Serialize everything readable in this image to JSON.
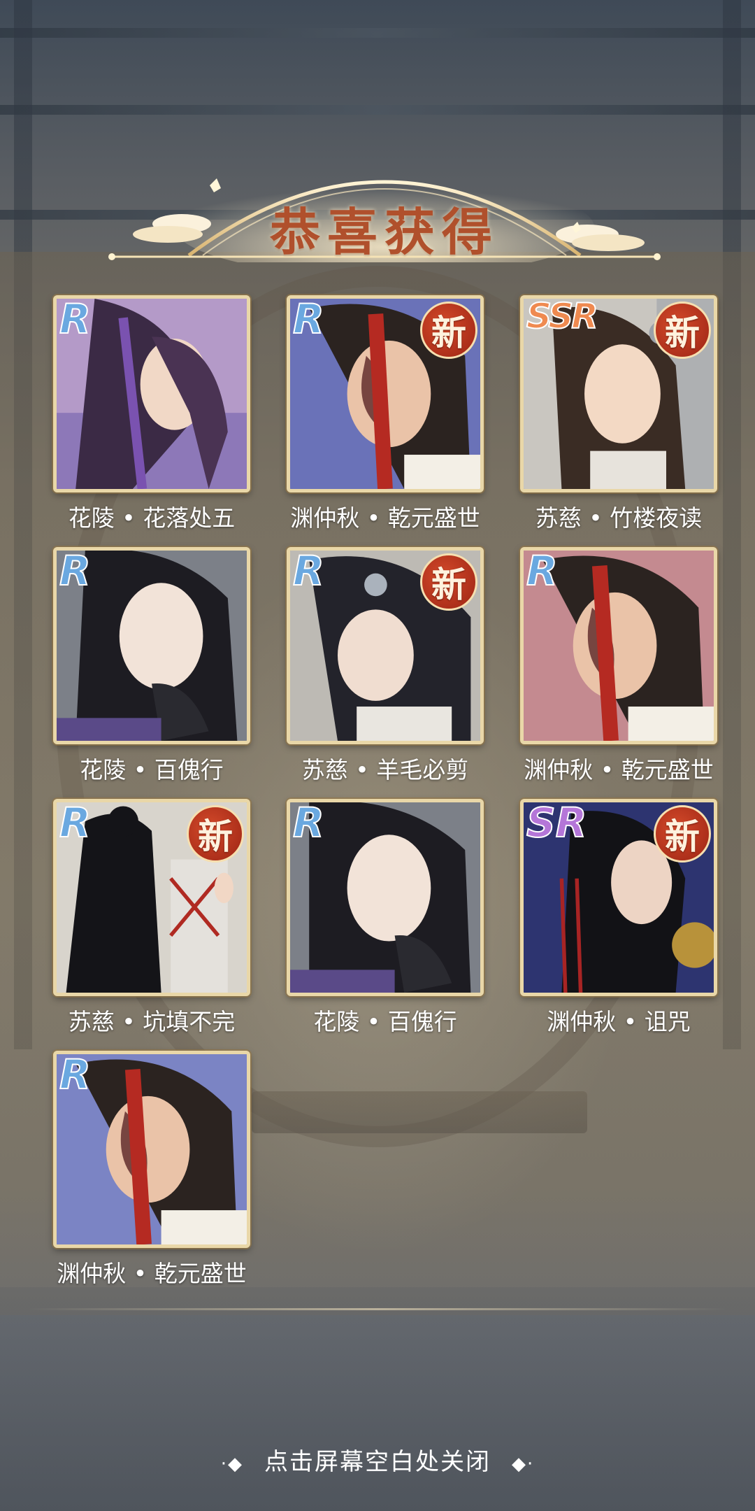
{
  "dialog": {
    "title": "恭喜获得",
    "close_hint": "点击屏幕空白处关闭"
  },
  "cards": [
    {
      "name": "花陵 • 花落处五",
      "rarity": "R",
      "is_new": false
    },
    {
      "name": "渊仲秋 • 乾元盛世",
      "rarity": "R",
      "is_new": true
    },
    {
      "name": "苏慈 • 竹楼夜读",
      "rarity": "SSR",
      "is_new": true
    },
    {
      "name": "花陵 • 百傀行",
      "rarity": "R",
      "is_new": false
    },
    {
      "name": "苏慈 • 羊毛必剪",
      "rarity": "R",
      "is_new": true
    },
    {
      "name": "渊仲秋 • 乾元盛世",
      "rarity": "R",
      "is_new": false
    },
    {
      "name": "苏慈 • 坑填不完",
      "rarity": "R",
      "is_new": true
    },
    {
      "name": "花陵 • 百傀行",
      "rarity": "R",
      "is_new": false
    },
    {
      "name": "渊仲秋 • 诅咒",
      "rarity": "SR",
      "is_new": true
    },
    {
      "name": "渊仲秋 • 乾元盛世",
      "rarity": "R",
      "is_new": false
    }
  ],
  "new_badge_label": "新",
  "colors": {
    "title": "#b0502c",
    "rarity_r": "#6aa8e0",
    "rarity_sr": "#b476d8",
    "rarity_ssr": "#ef8a50",
    "new_badge": "#c0381e",
    "frame": "#e9d7a8"
  }
}
